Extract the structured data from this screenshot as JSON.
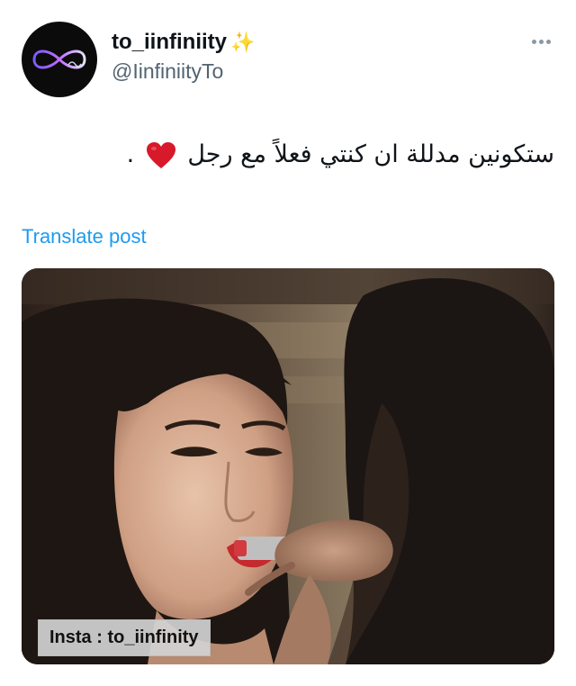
{
  "author": {
    "display_name": "to_iinfiniity",
    "emoji": "✨",
    "handle": "@IinfiniityTo",
    "avatar_icon": "infinity-icon"
  },
  "more_icon": "ellipsis-icon",
  "tweet": {
    "text": "ستكونين مدللة ان كنتي فعلاً مع رجل",
    "text_end": ".",
    "heart_icon": "red-heart-icon"
  },
  "translate_label": "Translate post",
  "media": {
    "watermark": "Insta : to_iinfinity"
  },
  "colors": {
    "link": "#1d9bf0",
    "secondary_text": "#536471",
    "heart": "#d7192a"
  }
}
